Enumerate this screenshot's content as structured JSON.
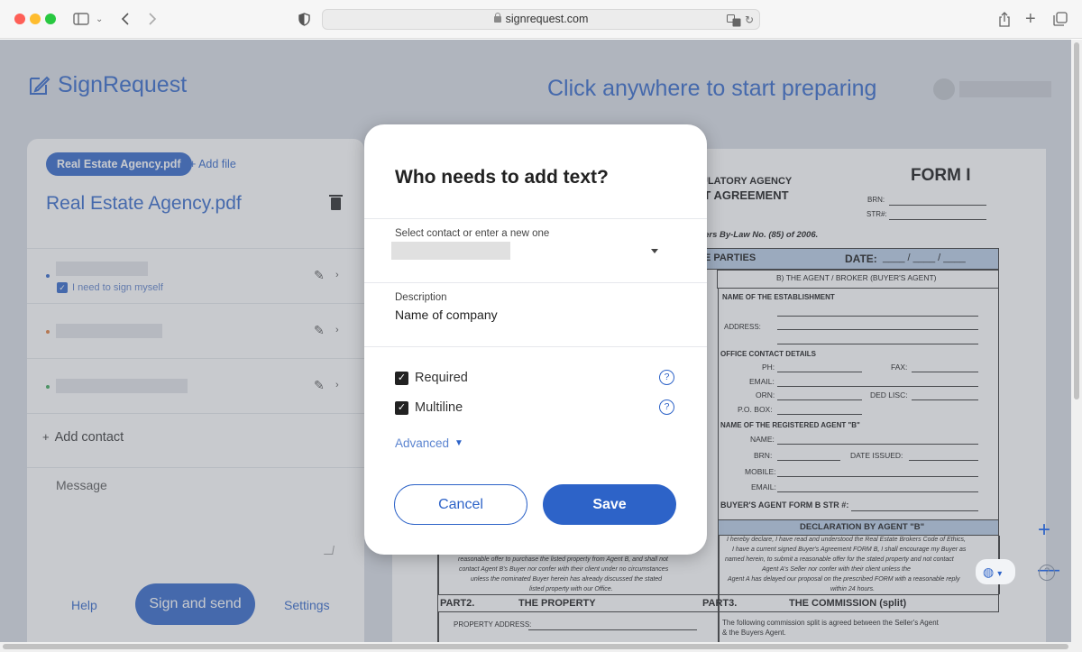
{
  "browser": {
    "url": "signrequest.com"
  },
  "app": {
    "logo_text": "SignRequest",
    "click_hint": "Click anywhere to start preparing"
  },
  "sidebar": {
    "file_pill": "Real Estate Agency.pdf",
    "add_file": "+ Add file",
    "file_title": "Real Estate Agency.pdf",
    "self_sign_label": "I need to sign myself",
    "add_contact": "Add contact",
    "message_placeholder": "Message",
    "help": "Help",
    "sign_and_send": "Sign and send",
    "settings": "Settings"
  },
  "modal": {
    "title": "Who needs to add text?",
    "contact_label": "Select contact or enter a new one",
    "description_label": "Description",
    "description_value": "Name of company",
    "required_label": "Required",
    "multiline_label": "Multiline",
    "advanced_label": "Advanced",
    "cancel": "Cancel",
    "save": "Save"
  },
  "document": {
    "heading1": "ULATORY AGENCY",
    "heading2": "NT AGREEMENT",
    "form_title": "FORM I",
    "brn": "BRN:",
    "str": "STR#:",
    "bylaw": "okers By-Law No. (85) of 2006.",
    "parties": "HE PARTIES",
    "date": "DATE:",
    "date_sep": "____ / ____ / ____",
    "agent_b": "B) THE AGENT / BROKER (BUYER'S AGENT)",
    "establishment": "NAME OF THE ESTABLISHMENT",
    "address": "ADDRESS:",
    "office_contact": "OFFICE CONTACT DETAILS",
    "ph": "PH:",
    "fax": "FAX:",
    "email": "EMAIL:",
    "orn": "ORN:",
    "ded": "DED LISC:",
    "pobox": "P.O. BOX:",
    "registered_agent": "NAME OF THE REGISTERED AGENT \"B\"",
    "name": "NAME:",
    "brn2": "BRN:",
    "date_issued": "DATE ISSUED:",
    "mobile": "MOBILE:",
    "email2": "EMAIL:",
    "form_b": "BUYER'S AGENT FORM B STR #:",
    "declaration": "DECLARATION BY AGENT \"B\"",
    "decl_text": [
      "I hereby declare, I have read and understood the Real Estate Brokers Code of Ethics,",
      "I have a current signed Buyer's Agreement FORM B, I shall encourage my Buyer as",
      "named herein, to submit a reasonable offer for the stated property and not contact",
      "Agent A's Seller nor confer with their client unless the",
      "Agent A has delayed our proposal on the prescribed FORM with a reasonable reply",
      "within 24 hours."
    ],
    "left_text": [
      "reasonable offer to purchase the listed property from Agent B, and shall not",
      "contact Agent B's Buyer nor confer with their client under no circumstances",
      "unless the nominated Buyer herein has already discussed the stated",
      "listed property with our Office."
    ],
    "part2": "PART2.",
    "the_property": "THE PROPERTY",
    "part3": "PART3.",
    "commission": "THE COMMISSION (split)",
    "property_address": "PROPERTY ADDRESS:",
    "commission_text1": "The following commission split is agreed between the Seller's Agent",
    "commission_text2": "& the Buyers Agent."
  },
  "colors": {
    "accent": "#2d63c8",
    "overlay": "#d9dde5"
  }
}
